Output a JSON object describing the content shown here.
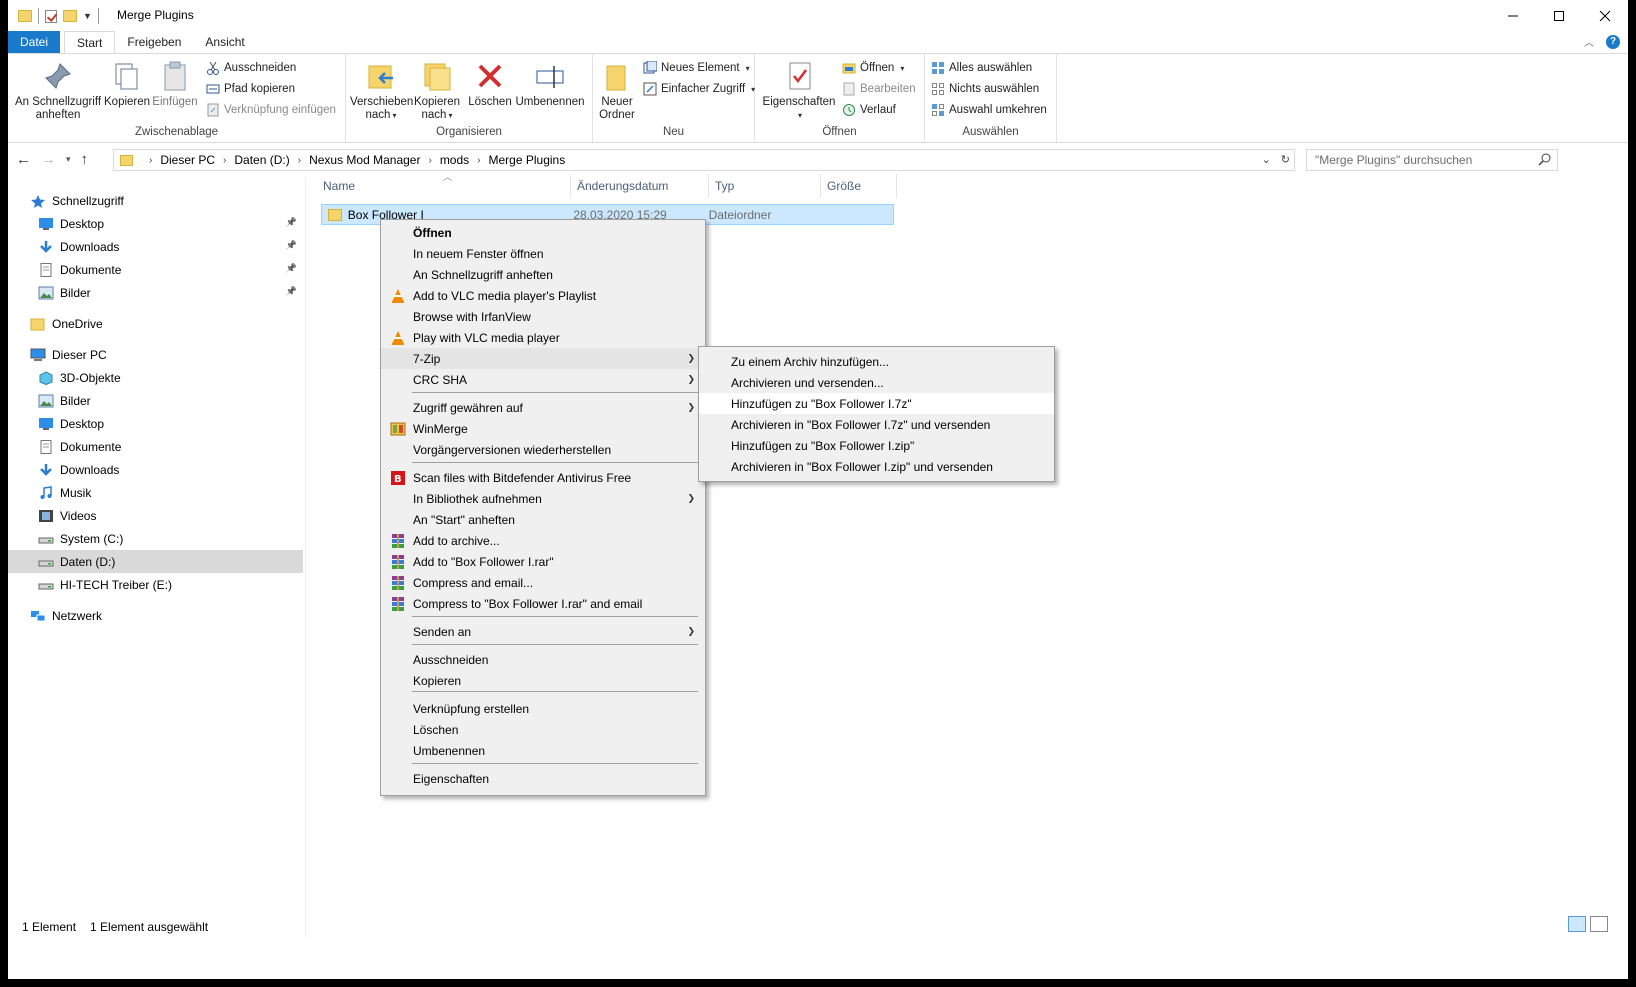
{
  "window": {
    "title": "Merge Plugins"
  },
  "tabs": [
    "Datei",
    "Start",
    "Freigeben",
    "Ansicht"
  ],
  "ribbon": {
    "clipboard": {
      "label": "Zwischenablage",
      "pin": "An Schnellzugriff anheften",
      "copy": "Kopieren",
      "paste": "Einfügen",
      "cut": "Ausschneiden",
      "copy_path": "Pfad kopieren",
      "paste_shortcut": "Verknüpfung einfügen"
    },
    "organize": {
      "label": "Organisieren",
      "move": "Verschieben nach",
      "copy_to": "Kopieren nach",
      "delete": "Löschen",
      "rename": "Umbenennen"
    },
    "new": {
      "label": "Neu",
      "new_folder": "Neuer Ordner",
      "new_item": "Neues Element",
      "easy_access": "Einfacher Zugriff"
    },
    "open": {
      "label": "Öffnen",
      "properties": "Eigenschaften",
      "open": "Öffnen",
      "edit": "Bearbeiten",
      "history": "Verlauf"
    },
    "select": {
      "label": "Auswählen",
      "select_all": "Alles auswählen",
      "select_none": "Nichts auswählen",
      "invert": "Auswahl umkehren"
    }
  },
  "address": {
    "crumbs": [
      "Dieser PC",
      "Daten (D:)",
      "Nexus Mod Manager",
      "mods",
      "Merge Plugins"
    ],
    "search_placeholder": "\"Merge Plugins\" durchsuchen"
  },
  "sidebar": {
    "items": [
      {
        "label": "Schnellzugriff",
        "icon": "star-icon"
      },
      {
        "label": "Desktop",
        "icon": "desktop-icon",
        "pinned": true
      },
      {
        "label": "Downloads",
        "icon": "download-icon",
        "pinned": true
      },
      {
        "label": "Dokumente",
        "icon": "document-icon",
        "pinned": true
      },
      {
        "label": "Bilder",
        "icon": "pictures-icon",
        "pinned": true
      },
      {
        "label": "OneDrive",
        "icon": "folder-icon"
      },
      {
        "label": "Dieser PC",
        "icon": "computer-icon"
      },
      {
        "label": "3D-Objekte",
        "icon": "cube-icon"
      },
      {
        "label": "Bilder",
        "icon": "pictures-icon"
      },
      {
        "label": "Desktop",
        "icon": "desktop-icon"
      },
      {
        "label": "Dokumente",
        "icon": "document-icon"
      },
      {
        "label": "Downloads",
        "icon": "download-icon"
      },
      {
        "label": "Musik",
        "icon": "music-icon"
      },
      {
        "label": "Videos",
        "icon": "video-icon"
      },
      {
        "label": "System (C:)",
        "icon": "drive-icon"
      },
      {
        "label": "Daten (D:)",
        "icon": "drive-icon",
        "selected": true
      },
      {
        "label": "HI-TECH Treiber (E:)",
        "icon": "drive-icon"
      },
      {
        "label": "Netzwerk",
        "icon": "network-icon"
      }
    ]
  },
  "list": {
    "columns": [
      "Name",
      "Änderungsdatum",
      "Typ",
      "Größe"
    ],
    "rows": [
      {
        "name": "Box Follower I",
        "date": "28.03.2020 15:29",
        "type": "Dateiordner",
        "size": ""
      }
    ]
  },
  "status": {
    "count": "1 Element",
    "selected": "1 Element ausgewählt"
  },
  "context_menu": {
    "items": [
      {
        "label": "Öffnen",
        "bold": true
      },
      {
        "label": "In neuem Fenster öffnen"
      },
      {
        "label": "An Schnellzugriff anheften"
      },
      {
        "label": "Add to VLC media player's Playlist",
        "icon": "vlc-icon"
      },
      {
        "label": "Browse with IrfanView"
      },
      {
        "label": "Play with VLC media player",
        "icon": "vlc-icon"
      },
      {
        "label": "7-Zip",
        "submenu": true,
        "highlighted": true
      },
      {
        "label": "CRC SHA",
        "submenu": true
      },
      {
        "label": "Zugriff gewähren auf",
        "submenu": true
      },
      {
        "label": "WinMerge",
        "icon": "winmerge-icon"
      },
      {
        "label": "Vorgängerversionen wiederherstellen"
      },
      {
        "label": "Scan files with Bitdefender Antivirus Free",
        "icon": "bitdefender-icon"
      },
      {
        "label": "In Bibliothek aufnehmen",
        "submenu": true
      },
      {
        "label": "An \"Start\" anheften"
      },
      {
        "label": "Add to archive...",
        "icon": "winrar-icon"
      },
      {
        "label": "Add to \"Box Follower I.rar\"",
        "icon": "winrar-icon"
      },
      {
        "label": "Compress and email...",
        "icon": "winrar-icon"
      },
      {
        "label": "Compress to \"Box Follower I.rar\" and email",
        "icon": "winrar-icon"
      },
      {
        "label": "Senden an",
        "submenu": true
      },
      {
        "label": "Ausschneiden"
      },
      {
        "label": "Kopieren"
      },
      {
        "label": "Verknüpfung erstellen"
      },
      {
        "label": "Löschen"
      },
      {
        "label": "Umbenennen"
      },
      {
        "label": "Eigenschaften"
      }
    ]
  },
  "submenu_7zip": {
    "items": [
      {
        "label": "Zu einem Archiv hinzufügen..."
      },
      {
        "label": "Archivieren und versenden..."
      },
      {
        "label": "Hinzufügen zu \"Box Follower I.7z\"",
        "highlighted": true
      },
      {
        "label": "Archivieren in \"Box Follower I.7z\" und versenden"
      },
      {
        "label": "Hinzufügen zu \"Box Follower I.zip\""
      },
      {
        "label": "Archivieren in \"Box Follower I.zip\" und versenden"
      }
    ]
  },
  "colors": {
    "accent": "#1979ca",
    "selection": "#cce8ff",
    "menu_bg": "#f0f0f0"
  }
}
